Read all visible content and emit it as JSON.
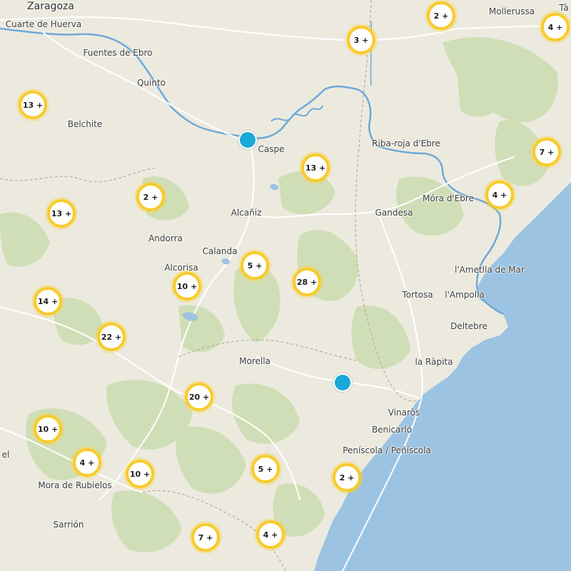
{
  "map": {
    "colors": {
      "land": "#eceadf",
      "sea": "#9cc3e2",
      "forest": "#c9dbae",
      "river": "#6fa9d8",
      "cluster_ring": "#f8cb2a",
      "marker": "#17a9d9"
    },
    "places": [
      {
        "name": "Zaragoza",
        "size": "large"
      },
      {
        "name": "Cuarte de Huerva",
        "size": "normal"
      },
      {
        "name": "Fuentes de Ebro",
        "size": "normal"
      },
      {
        "name": "Quinto",
        "size": "normal"
      },
      {
        "name": "Belchite",
        "size": "normal"
      },
      {
        "name": "Caspe",
        "size": "normal"
      },
      {
        "name": "Mollerussa",
        "size": "normal"
      },
      {
        "name": "Tà",
        "size": "normal"
      },
      {
        "name": "Riba-roja d'Ebre",
        "size": "normal"
      },
      {
        "name": "Móra d'Ebre",
        "size": "normal"
      },
      {
        "name": "Alcañiz",
        "size": "normal"
      },
      {
        "name": "Gandesa",
        "size": "normal"
      },
      {
        "name": "Andorra",
        "size": "normal"
      },
      {
        "name": "Calanda",
        "size": "normal"
      },
      {
        "name": "Alcorisa",
        "size": "normal"
      },
      {
        "name": "l'Ametlla de Mar",
        "size": "normal"
      },
      {
        "name": "Tortosa",
        "size": "normal"
      },
      {
        "name": "l'Ampolla",
        "size": "normal"
      },
      {
        "name": "Deltebre",
        "size": "normal"
      },
      {
        "name": "Morella",
        "size": "normal"
      },
      {
        "name": "la Ràpita",
        "size": "normal"
      },
      {
        "name": "Vinaròs",
        "size": "normal"
      },
      {
        "name": "Benicarló",
        "size": "normal"
      },
      {
        "name": "Peníscola / Peñíscola",
        "size": "normal"
      },
      {
        "name": "el",
        "size": "normal"
      },
      {
        "name": "Mora de Rubielos",
        "size": "normal"
      },
      {
        "name": "Sarrión",
        "size": "normal"
      }
    ],
    "clusters": [
      {
        "label": "2 +"
      },
      {
        "label": "3 +"
      },
      {
        "label": "4 +"
      },
      {
        "label": "13 +"
      },
      {
        "label": "13 +"
      },
      {
        "label": "7 +"
      },
      {
        "label": "2 +"
      },
      {
        "label": "4 +"
      },
      {
        "label": "13 +"
      },
      {
        "label": "5 +"
      },
      {
        "label": "28 +"
      },
      {
        "label": "10 +"
      },
      {
        "label": "14 +"
      },
      {
        "label": "22 +"
      },
      {
        "label": "20 +"
      },
      {
        "label": "10 +"
      },
      {
        "label": "4 +"
      },
      {
        "label": "10 +"
      },
      {
        "label": "5 +"
      },
      {
        "label": "2 +"
      },
      {
        "label": "7 +"
      },
      {
        "label": "4 +"
      }
    ],
    "markers": [
      {
        "name": "location-marker"
      },
      {
        "name": "location-marker"
      }
    ]
  }
}
